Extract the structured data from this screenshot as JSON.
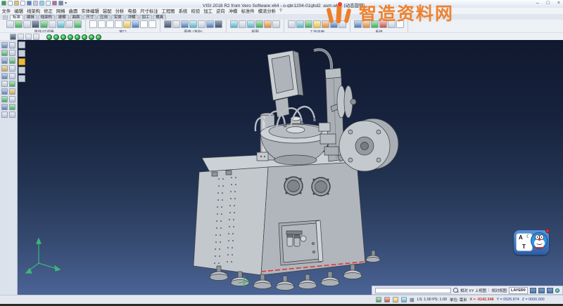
{
  "window": {
    "title": "VISI 2018 R2 from Vero Software x64 - o-qbr1204-01ghd2_asm.wkf - [动态旋转]",
    "minimize_glyph": "–",
    "maximize_glyph": "□",
    "close_glyph": "×",
    "dropdown_glyph": "▾"
  },
  "menubar": {
    "items": [
      "文件",
      "编辑",
      "线架构",
      "修正",
      "网格",
      "曲面",
      "实体编辑",
      "装配",
      "分析",
      "电极",
      "尺寸标注",
      "工程图",
      "系统",
      "校验",
      "加工",
      "逆向",
      "冲模",
      "标准件",
      "模流分析",
      "?"
    ]
  },
  "tabrow": {
    "dash": "-",
    "items": [
      "标准",
      "编辑",
      "线架构",
      "建模",
      "曲面",
      "尺寸",
      "应用",
      "实体",
      "冲模",
      "加工",
      "模具"
    ]
  },
  "toolbar": {
    "groups": [
      {
        "label": "属性/过滤器"
      },
      {
        "label": "窗口"
      },
      {
        "label": "图像 (渲染)"
      },
      {
        "label": "视图"
      },
      {
        "label": "工作平面"
      },
      {
        "label": "系统"
      }
    ]
  },
  "watermark": {
    "text": "智造资料网",
    "color": "#ee7e28"
  },
  "statusbar": {
    "view_mode": "相对 XY 上视图",
    "view_ref": "相对视图",
    "layer": "LAYER0",
    "scale": "LS: 1.00 PS: 1.00",
    "units": "单位: 毫米",
    "coord_x": "X = -0142.348",
    "coord_y": "Y = 0926.874",
    "coord_z": "Z = 0000.000"
  },
  "ime": {
    "letter_a": "A",
    "moon_glyph": "☾",
    "letter_t": "T"
  },
  "icons": {
    "search-icon": "css-circle-handle",
    "grid-icon": "⊞",
    "minimize-icon": "–",
    "maximize-icon": "□",
    "close-icon": "×"
  },
  "colors": {
    "watermark_orange": "#ee7e28",
    "coord_x_red": "#c03320",
    "coord_yz_blue": "#1d3f8f",
    "viewport_top": "#10192f",
    "viewport_bottom": "#4b6496"
  }
}
